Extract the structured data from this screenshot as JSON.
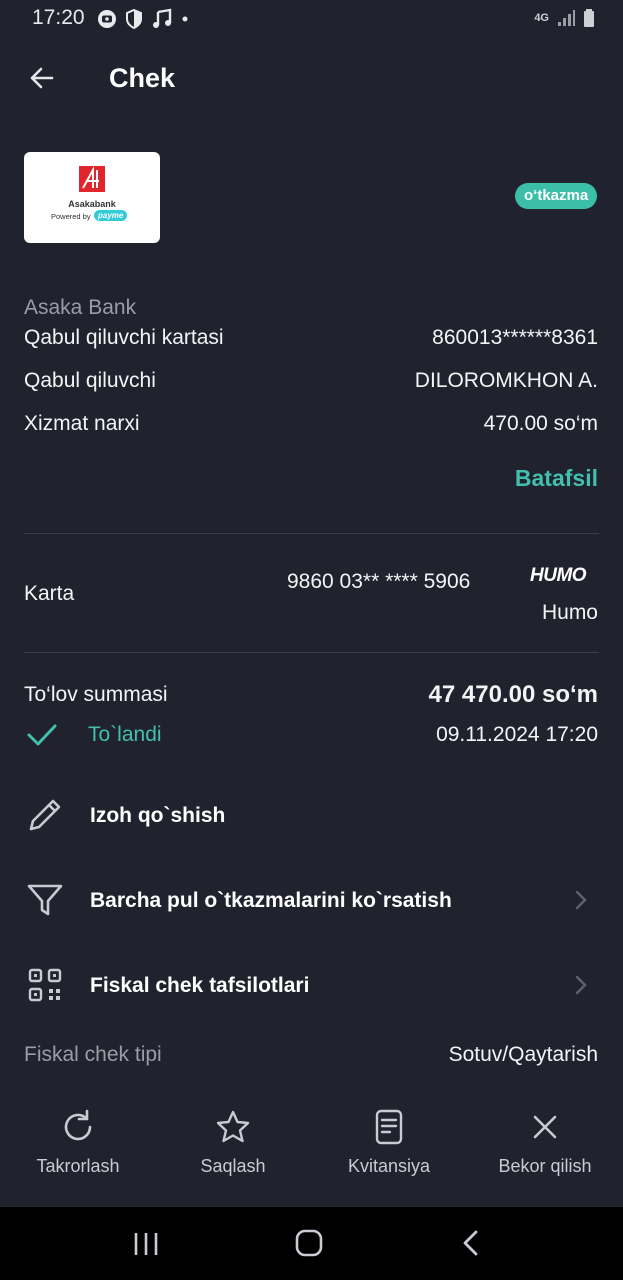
{
  "status_bar": {
    "time": "17:20",
    "network": "4G"
  },
  "header": {
    "title": "Chek"
  },
  "merchant": {
    "logo_name": "Asakabank",
    "logo_powered": "Powered by",
    "logo_payme": "payme",
    "badge": "o‘tkazma",
    "bank_name": "Asaka Bank"
  },
  "details": [
    {
      "label": "Qabul qiluvchi kartasi",
      "value": "860013******8361"
    },
    {
      "label": "Qabul qiluvchi",
      "value": "DILOROMKHON A."
    },
    {
      "label": "Xizmat narxi",
      "value": "470.00 so‘m"
    }
  ],
  "more_link": "Batafsil",
  "card": {
    "label": "Karta",
    "number": "9860 03** **** 5906",
    "brand_logo": "HUMO",
    "brand": "Humo"
  },
  "payment": {
    "label": "To‘lov summasi",
    "amount": "47 470.00 so‘m",
    "status": "To`landi",
    "datetime": "09.11.2024 17:20"
  },
  "actions": [
    {
      "label": "Izoh qo`shish",
      "icon": "pencil-icon"
    },
    {
      "label": "Barcha pul o`tkazmalarini ko`rsatish",
      "icon": "filter-icon"
    },
    {
      "label": "Fiskal chek tafsilotlari",
      "icon": "qr-code-icon"
    }
  ],
  "fiscal": {
    "label": "Fiskal chek tipi",
    "value": "Sotuv/Qaytarish"
  },
  "toolbar": [
    {
      "label": "Takrorlash",
      "icon": "repeat-icon"
    },
    {
      "label": "Saqlash",
      "icon": "star-icon"
    },
    {
      "label": "Kvitansiya",
      "icon": "receipt-icon"
    },
    {
      "label": "Bekor qilish",
      "icon": "close-icon"
    }
  ],
  "colors": {
    "background": "#20222e",
    "accent": "#42bfae",
    "badge": "#3bbfa8"
  }
}
